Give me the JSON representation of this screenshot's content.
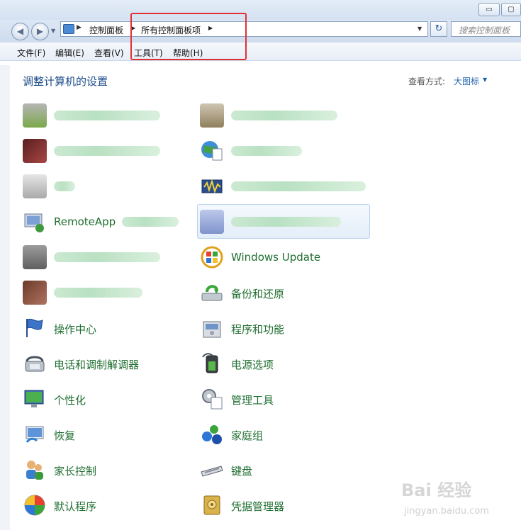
{
  "window": {
    "minimize_glyph": "▭",
    "maximize_glyph": "▢"
  },
  "address": {
    "crumbs": [
      "控制面板",
      "所有控制面板项"
    ],
    "search_placeholder": "搜索控制面板"
  },
  "menu": [
    "文件(F)",
    "编辑(E)",
    "查看(V)",
    "工具(T)",
    "帮助(H)"
  ],
  "header": {
    "title": "调整计算机的设置",
    "view_by_label": "查看方式:",
    "view_by_value": "大图标"
  },
  "items": {
    "remoteapp": "RemoteApp",
    "windows_update": "Windows Update",
    "backup": "备份和还原",
    "action_center": "操作中心",
    "programs": "程序和功能",
    "phone_modem": "电话和调制解调器",
    "power": "电源选项",
    "personalization": "个性化",
    "admin_tools": "管理工具",
    "recovery": "恢复",
    "homegroup": "家庭组",
    "parental": "家长控制",
    "keyboard": "键盘",
    "default_programs": "默认程序",
    "credential": "凭据管理器"
  },
  "watermark": {
    "logo": "Bai 经验",
    "url": "jingyan.baidu.com"
  },
  "icons": {
    "back": "back-arrow-icon",
    "forward": "forward-arrow-icon",
    "refresh": "refresh-icon"
  }
}
